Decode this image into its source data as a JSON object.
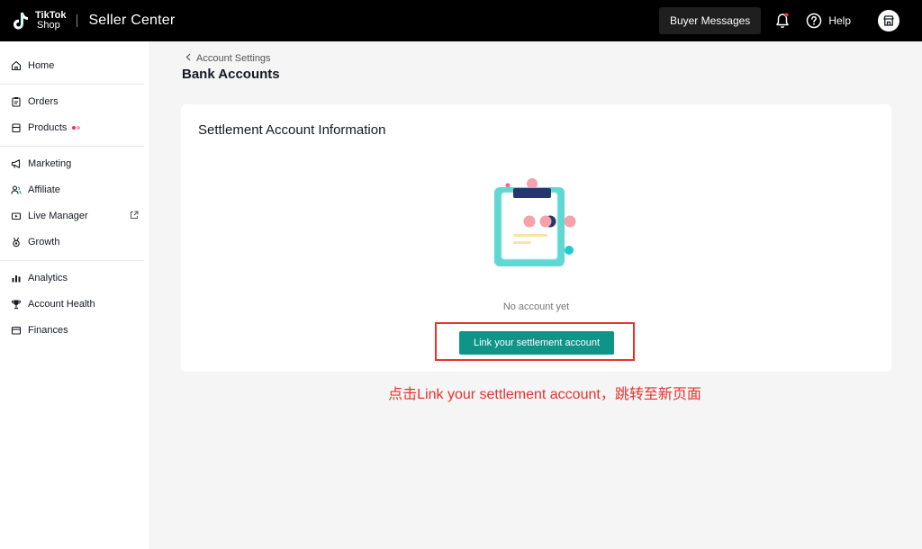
{
  "header": {
    "logo_line1": "TikTok",
    "logo_line2": "Shop",
    "app_title": "Seller Center",
    "buyer_messages_label": "Buyer Messages",
    "help_label": "Help",
    "notification_dot_color": "#fe2c55"
  },
  "sidebar": {
    "items": [
      {
        "label": "Home",
        "icon": "home-icon"
      },
      {
        "label": "Orders",
        "icon": "clipboard-icon"
      },
      {
        "label": "Products",
        "icon": "box-icon",
        "badge": true
      },
      {
        "label": "Marketing",
        "icon": "megaphone-icon"
      },
      {
        "label": "Affiliate",
        "icon": "people-icon"
      },
      {
        "label": "Live Manager",
        "icon": "live-icon",
        "external": true
      },
      {
        "label": "Growth",
        "icon": "medal-icon"
      },
      {
        "label": "Analytics",
        "icon": "bar-chart-icon"
      },
      {
        "label": "Account Health",
        "icon": "trophy-icon"
      },
      {
        "label": "Finances",
        "icon": "wallet-icon"
      }
    ]
  },
  "main": {
    "breadcrumb": "Account Settings",
    "page_title": "Bank Accounts",
    "card": {
      "title": "Settlement Account Information",
      "empty_text": "No account yet",
      "link_button_label": "Link your settlement account"
    },
    "annotation": "点击Link your settlement account，跳转至新页面"
  },
  "colors": {
    "accent": "#0f9488",
    "annotation_red": "#e8322d",
    "topbar": "#000000"
  }
}
